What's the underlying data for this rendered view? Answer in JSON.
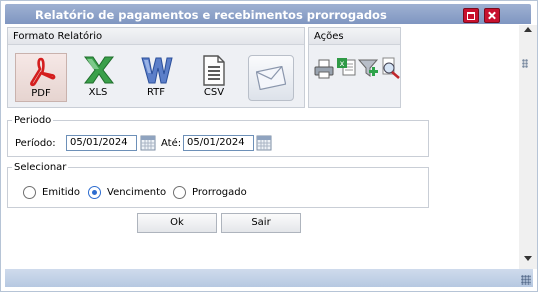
{
  "window": {
    "title": "Relatório de pagamentos e recebimentos prorrogados"
  },
  "formato": {
    "header": "Formato Relatório",
    "buttons": [
      {
        "label": "PDF",
        "icon": "pdf-icon",
        "selected": true
      },
      {
        "label": "XLS",
        "icon": "xls-icon",
        "selected": false
      },
      {
        "label": "RTF",
        "icon": "rtf-icon",
        "selected": false
      },
      {
        "label": "CSV",
        "icon": "csv-icon",
        "selected": false
      },
      {
        "label": "",
        "icon": "email-icon",
        "selected": false
      }
    ]
  },
  "acoes": {
    "header": "Ações",
    "icons": [
      "print-icon",
      "excel-icon",
      "filter-add-icon",
      "search-report-icon"
    ]
  },
  "periodo": {
    "legend": "Periodo",
    "label_from": "Período:",
    "from_value": "05/01/2024",
    "label_to": "Até:",
    "to_value": "05/01/2024"
  },
  "selecionar": {
    "legend": "Selecionar",
    "options": [
      {
        "label": "Emitido",
        "checked": false
      },
      {
        "label": "Vencimento",
        "checked": true
      },
      {
        "label": "Prorrogado",
        "checked": false
      }
    ]
  },
  "buttons": {
    "ok": "Ok",
    "exit": "Sair"
  }
}
